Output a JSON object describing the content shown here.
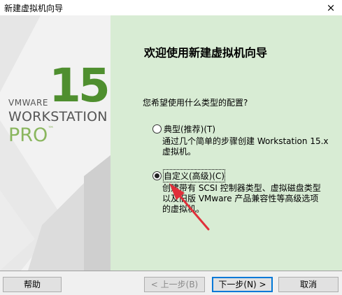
{
  "window": {
    "title": "新建虚拟机向导",
    "close_glyph": "×"
  },
  "branding": {
    "version": "15",
    "vendor": "VMWARE",
    "product": "WORKSTATION",
    "edition": "PRO",
    "trademark": "™"
  },
  "content": {
    "heading": "欢迎使用新建虚拟机向导",
    "question": "您希望使用什么类型的配置?",
    "options": [
      {
        "label": "典型(推荐)(T)",
        "description_lines": [
          "通过几个简单的步骤创建 Workstation 15.x",
          "虚拟机。"
        ],
        "selected": false
      },
      {
        "label": "自定义(高级)(C)",
        "description_lines": [
          "创建带有 SCSI 控制器类型、虚拟磁盘类型",
          "以及旧版 VMware 产品兼容性等高级选项",
          "的虚拟机。"
        ],
        "selected": true
      }
    ]
  },
  "buttons": {
    "help": "帮助",
    "back": "< 上一步(B)",
    "next": "下一步(N) >",
    "cancel": "取消"
  },
  "colors": {
    "brand_green": "#4f8f2f",
    "pro_green": "#8ab65e",
    "panel_bg": "#d8ecd4",
    "annotation_arrow": "#e0303a",
    "focus_blue": "#0078d7"
  }
}
